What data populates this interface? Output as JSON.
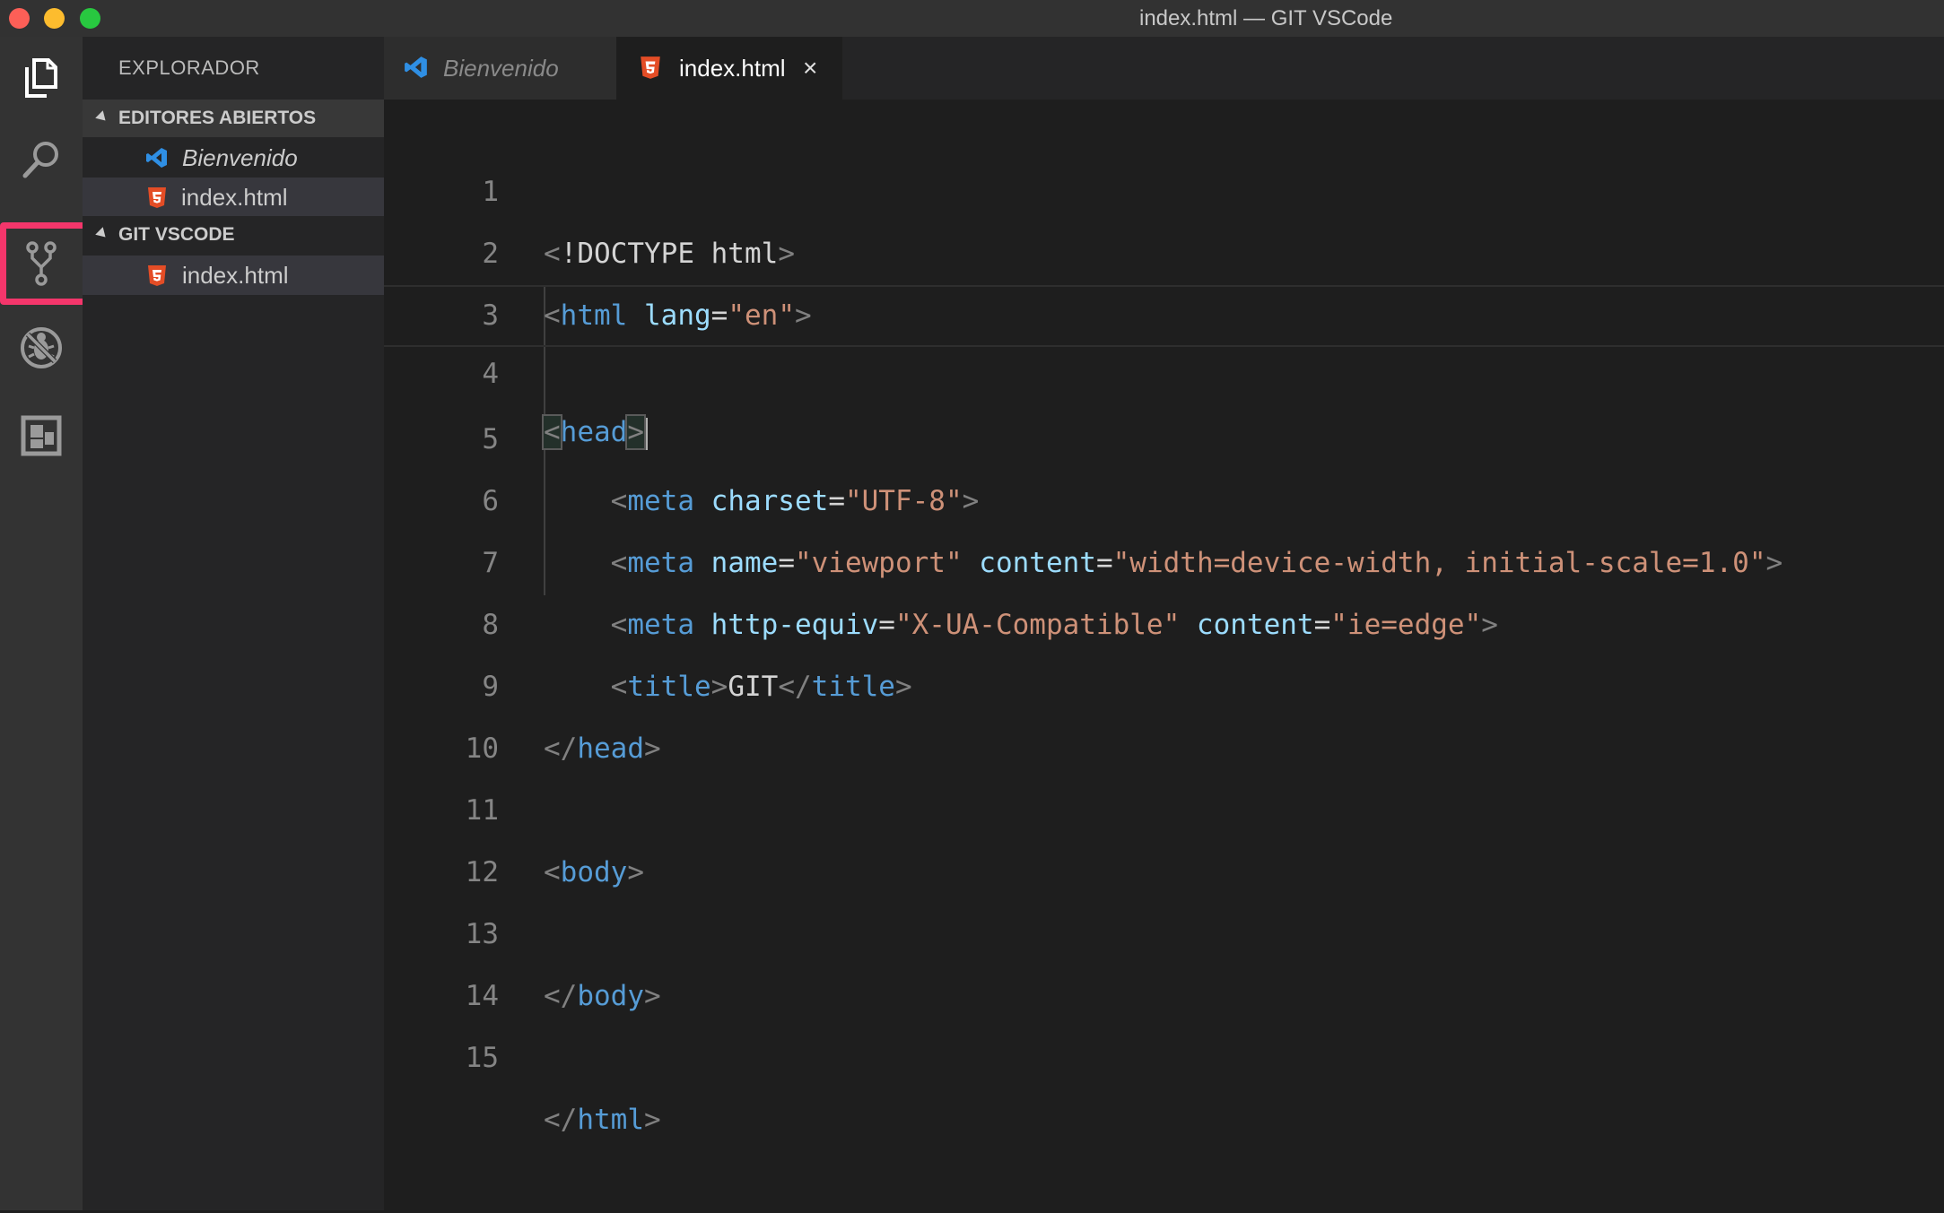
{
  "window": {
    "title": "index.html — GIT VSCode"
  },
  "activity_bar": {
    "items": [
      {
        "name": "explorer",
        "icon": "files-icon"
      },
      {
        "name": "search",
        "icon": "search-icon"
      },
      {
        "name": "source-control",
        "icon": "git-branch-icon",
        "highlighted": true
      },
      {
        "name": "debug",
        "icon": "no-bug-icon"
      },
      {
        "name": "extensions",
        "icon": "extensions-icon"
      }
    ],
    "highlight_color": "#f4366b"
  },
  "sidebar": {
    "title": "EXPLORADOR",
    "open_editors": {
      "header": "EDITORES ABIERTOS",
      "files": [
        {
          "label": "Bienvenido",
          "icon": "vscode-icon",
          "italic": true
        },
        {
          "label": "index.html",
          "icon": "html5-icon",
          "selected": true
        }
      ]
    },
    "folder": {
      "header": "GIT VSCODE",
      "files": [
        {
          "label": "index.html",
          "icon": "html5-icon",
          "selected": true
        }
      ]
    }
  },
  "tabs": [
    {
      "label": "Bienvenido",
      "icon": "vscode-icon",
      "active": false
    },
    {
      "label": "index.html",
      "icon": "html5-icon",
      "active": true,
      "close": "×"
    }
  ],
  "editor": {
    "lines": [
      {
        "n": "1"
      },
      {
        "n": "2"
      },
      {
        "n": "3"
      },
      {
        "n": "4"
      },
      {
        "n": "5"
      },
      {
        "n": "6"
      },
      {
        "n": "7"
      },
      {
        "n": "8"
      },
      {
        "n": "9"
      },
      {
        "n": "10"
      },
      {
        "n": "11"
      },
      {
        "n": "12"
      },
      {
        "n": "13"
      },
      {
        "n": "14"
      },
      {
        "n": "15"
      }
    ],
    "code": {
      "l1_doctype": "!DOCTYPE html",
      "l2_tag": "html",
      "l2_attr": "lang",
      "l2_val": "\"en\"",
      "l4_tag": "head",
      "l5_tag": "meta",
      "l5_attr": "charset",
      "l5_val": "\"UTF-8\"",
      "l6_tag": "meta",
      "l6_attr1": "name",
      "l6_val1": "\"viewport\"",
      "l6_attr2": "content",
      "l6_val2": "\"width=device-width, initial-scale=1.0\"",
      "l7_tag": "meta",
      "l7_attr1": "http-equiv",
      "l7_val1": "\"X-UA-Compatible\"",
      "l7_attr2": "content",
      "l7_val2": "\"ie=edge\"",
      "l8_tag_open": "title",
      "l8_text": "GIT",
      "l8_tag_close": "title",
      "l9_tag": "head",
      "l11_tag": "body",
      "l13_tag": "body",
      "l15_tag": "html"
    }
  },
  "colors": {
    "background": "#1e1e1e",
    "sidebar": "#252526",
    "activity_bar": "#333333",
    "tag": "#569cd6",
    "attribute": "#9cdcfe",
    "string": "#ce9178",
    "punctuation": "#808080",
    "html_icon": "#e44d26",
    "vscode_icon": "#2f8fe4"
  }
}
